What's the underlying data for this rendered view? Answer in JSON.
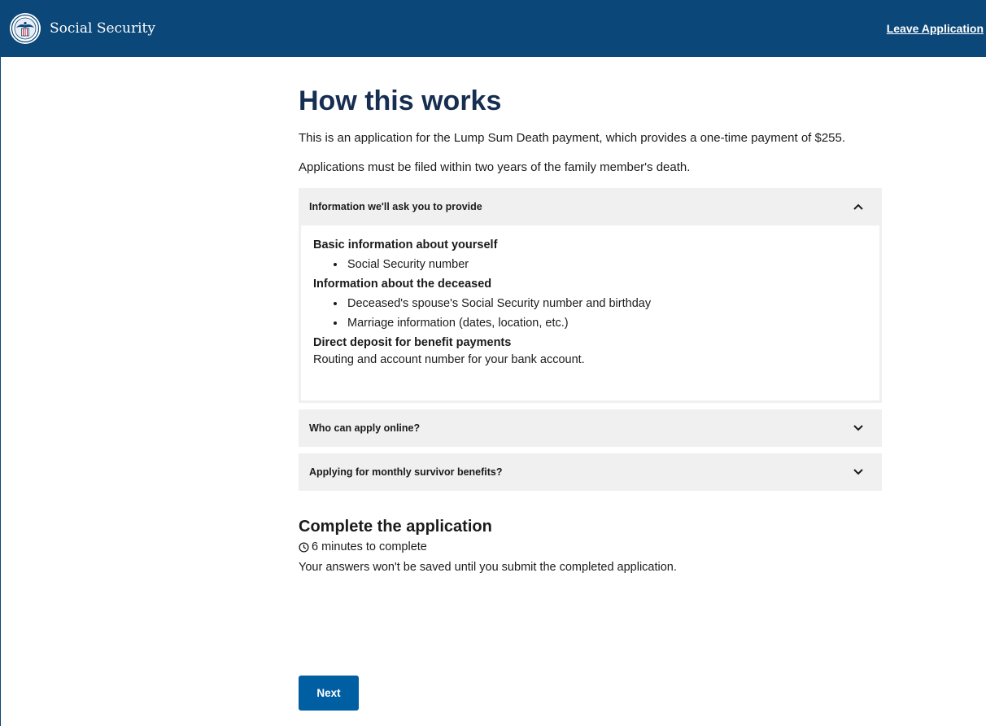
{
  "header": {
    "brand": "Social Security",
    "leave_label": "Leave Application",
    "background": "#0b4778"
  },
  "main": {
    "title": "How this works",
    "intro": "This is an application for the Lump Sum Death payment, which provides a one-time payment of $255.",
    "deadline": "Applications must be filed within two years of the family member's death."
  },
  "accordion": {
    "info": {
      "label": "Information we'll ask you to provide",
      "expanded": true,
      "sections": {
        "yourself": {
          "heading": "Basic information about yourself",
          "items": [
            "Social Security number"
          ]
        },
        "deceased": {
          "heading": "Information about the deceased",
          "items": [
            "Deceased's spouse's Social Security number and birthday",
            "Marriage information (dates, location, etc.)"
          ]
        },
        "deposit": {
          "heading": "Direct deposit for benefit payments",
          "text": "Routing and account number for your bank account."
        }
      }
    },
    "who": {
      "label": "Who can apply online?",
      "expanded": false
    },
    "monthly": {
      "label": "Applying for monthly survivor benefits?",
      "expanded": false
    }
  },
  "complete": {
    "title": "Complete the application",
    "duration": "6 minutes to complete",
    "note": "Your answers won't be saved until you submit the completed application."
  },
  "next_label": "Next",
  "colors": {
    "accent": "#005ea2",
    "title": "#162e51",
    "accordion_bg": "#f0f0f0"
  },
  "icons": {
    "seal": "ssa-seal-icon",
    "chevron_up": "chevron-up-icon",
    "chevron_down": "chevron-down-icon",
    "clock": "clock-icon"
  }
}
